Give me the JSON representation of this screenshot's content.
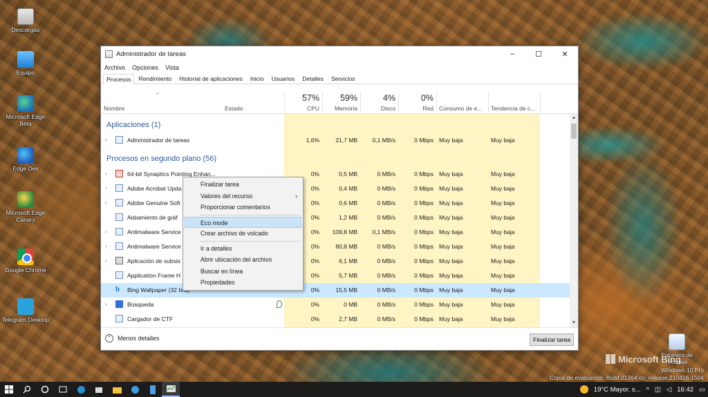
{
  "desktop": {
    "icons": [
      {
        "label": "Descargas",
        "icon": "downloads-folder-icon"
      },
      {
        "label": "Equipo",
        "icon": "computer-icon"
      },
      {
        "label": "Microsoft Edge Beta",
        "icon": "edge-beta-icon"
      },
      {
        "label": "Edge Dev",
        "icon": "edge-dev-icon"
      },
      {
        "label": "Microsoft Edge Canary",
        "icon": "edge-canary-icon"
      },
      {
        "label": "Google Chrome",
        "icon": "chrome-icon"
      },
      {
        "label": "Telegram Desktop",
        "icon": "telegram-icon"
      }
    ],
    "recycle_bin": "Papelera de reciclaje",
    "brand": "Microsoft Bing",
    "watermark_line1": "Windows 10 Pro",
    "watermark_line2": "Copia de evaluación. Build 21364.co_release.210416-1504"
  },
  "window": {
    "title": "Administrador de tareas",
    "controls": {
      "minimize": "–",
      "maximize": "☐",
      "close": "✕"
    },
    "menu": [
      "Archivo",
      "Opciones",
      "Vista"
    ],
    "tabs": [
      "Procesos",
      "Rendimiento",
      "Historial de aplicaciones",
      "Inicio",
      "Usuarios",
      "Detalles",
      "Servicios"
    ],
    "active_tab": "Procesos"
  },
  "columns": {
    "name": "Nombre",
    "status": "Estado",
    "cpu": {
      "pct": "57%",
      "label": "CPU"
    },
    "memory": {
      "pct": "59%",
      "label": "Memoria"
    },
    "disk": {
      "pct": "4%",
      "label": "Disco"
    },
    "network": {
      "pct": "0%",
      "label": "Red"
    },
    "energy": "Consumo de e...",
    "energy_trend": "Tendencia de c..."
  },
  "groups": {
    "apps": "Aplicaciones (1)",
    "background": "Procesos en segundo plano (56)"
  },
  "rows": [
    {
      "name": "Administrador de tareas",
      "cpu": "1,6%",
      "mem": "21,7 MB",
      "disk": "0,1 MB/s",
      "net": "0 Mbps",
      "energy": "Muy baja",
      "trend": "Muy baja"
    },
    {
      "name": "64-bit Synaptics Pointing Enhan...",
      "cpu": "0%",
      "mem": "0,5 MB",
      "disk": "0 MB/s",
      "net": "0 Mbps",
      "energy": "Muy baja",
      "trend": "Muy baja"
    },
    {
      "name": "Adobe Acrobat Upda",
      "cpu": "0%",
      "mem": "0,4 MB",
      "disk": "0 MB/s",
      "net": "0 Mbps",
      "energy": "Muy baja",
      "trend": "Muy baja"
    },
    {
      "name": "Adobe Genuine Soft",
      "cpu": "0%",
      "mem": "0,6 MB",
      "disk": "0 MB/s",
      "net": "0 Mbps",
      "energy": "Muy baja",
      "trend": "Muy baja"
    },
    {
      "name": "Aislamiento de gráf",
      "cpu": "0%",
      "mem": "1,2 MB",
      "disk": "0 MB/s",
      "net": "0 Mbps",
      "energy": "Muy baja",
      "trend": "Muy baja"
    },
    {
      "name": "Antimalware Service",
      "cpu": "0%",
      "mem": "109,8 MB",
      "disk": "0,1 MB/s",
      "net": "0 Mbps",
      "energy": "Muy baja",
      "trend": "Muy baja"
    },
    {
      "name": "Antimalware Service",
      "cpu": "0%",
      "mem": "80,8 MB",
      "disk": "0 MB/s",
      "net": "0 Mbps",
      "energy": "Muy baja",
      "trend": "Muy baja"
    },
    {
      "name": "Aplicación de subsis",
      "cpu": "0%",
      "mem": "6,1 MB",
      "disk": "0 MB/s",
      "net": "0 Mbps",
      "energy": "Muy baja",
      "trend": "Muy baja"
    },
    {
      "name": "Application Frame H",
      "cpu": "0%",
      "mem": "5,7 MB",
      "disk": "0 MB/s",
      "net": "0 Mbps",
      "energy": "Muy baja",
      "trend": "Muy baja"
    },
    {
      "name": "Bing Wallpaper (32 bits)",
      "cpu": "0%",
      "mem": "15,5 MB",
      "disk": "0 MB/s",
      "net": "0 Mbps",
      "energy": "Muy baja",
      "trend": "Muy baja"
    },
    {
      "name": "Búsqueda",
      "cpu": "0%",
      "mem": "0 MB",
      "disk": "0 MB/s",
      "net": "0 Mbps",
      "energy": "Muy baja",
      "trend": "Muy baja"
    },
    {
      "name": "Cargador de CTF",
      "cpu": "0%",
      "mem": "2,7 MB",
      "disk": "0 MB/s",
      "net": "0 Mbps",
      "energy": "Muy baja",
      "trend": "Muy baja"
    }
  ],
  "footer": {
    "less_details": "Menos detalles",
    "end_task": "Finalizar tarea"
  },
  "context_menu": {
    "items": [
      "Finalizar tarea",
      "Valores del recurso",
      "Proporcionar comentarios",
      "Eco mode",
      "Crear archivo de volcado",
      "Ir a detalles",
      "Abrir ubicación del archivo",
      "Buscar en línea",
      "Propiedades"
    ],
    "submenu_arrow": "›"
  },
  "taskbar": {
    "weather": "19°C  Mayor. s...",
    "time": "16:42"
  }
}
